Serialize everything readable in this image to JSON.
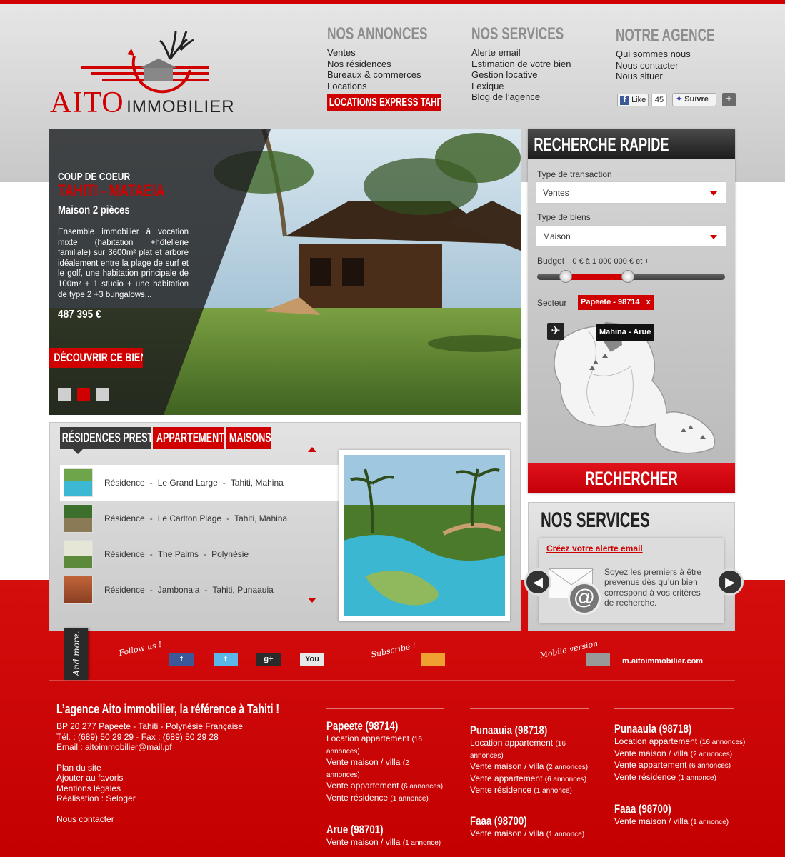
{
  "brand": {
    "name_main": "AITO",
    "name_sub": "IMMOBILIER"
  },
  "nav": {
    "annonces": {
      "title": "NOS ANNONCES",
      "items": [
        "Ventes",
        "Nos résidences",
        "Bureaux & commerces",
        "Locations"
      ],
      "highlight": "LOCATIONS EXPRESS TAHITI"
    },
    "services": {
      "title": "NOS SERVICES",
      "items": [
        "Alerte email",
        "Estimation de votre bien",
        "Gestion locative",
        "Lexique",
        "Blog de l’agence"
      ]
    },
    "agence": {
      "title": "NOTRE AGENCE",
      "items": [
        "Qui sommes nous",
        "Nous contacter",
        "Nous situer"
      ]
    }
  },
  "social_top": {
    "like_label": "Like",
    "like_count": "45",
    "follow_label": "Suivre",
    "plus_label": "+"
  },
  "hero": {
    "kicker": "COUP DE COEUR",
    "location": "TAHITI - MATAEIA",
    "type": "Maison 2 pièces",
    "description": "Ensemble immobilier à vocation mixte (habitation +hôtellerie familiale) sur 3600m² plat et arboré idéalement entre la plage de surf et le golf, une habitation principale de 100m² + 1 studio + une habitation de type 2 +3 bungalows...",
    "price": "487 395 €",
    "cta": "DÉCOUVRIR CE BIEN",
    "slides": [
      false,
      true,
      false
    ]
  },
  "search": {
    "title": "RECHERCHE RAPIDE",
    "transaction_label": "Type de transaction",
    "transaction_value": "Ventes",
    "biens_label": "Type de biens",
    "biens_value": "Maison",
    "budget_label": "Budget",
    "budget_value": "0 € à 1 000 000 € et +",
    "budget_range": [
      0,
      0.33
    ],
    "secteur_label": "Secteur",
    "secteur_tag": "Papeete - 98714",
    "secteur_remove": "x",
    "map_tooltip": "Mahina - Arue",
    "button": "RECHERCHER"
  },
  "residences": {
    "tabs": [
      "RÉSIDENCES PRESTIGE",
      "APPARTEMENTS",
      "MAISONS"
    ],
    "items": [
      {
        "kind": "Résidence",
        "name": "Le Grand Large",
        "place": "Tahiti, Mahina"
      },
      {
        "kind": "Résidence",
        "name": "Le Carlton Plage",
        "place": "Tahiti, Mahina"
      },
      {
        "kind": "Résidence",
        "name": "The Palms",
        "place": "Polynésie"
      },
      {
        "kind": "Résidence",
        "name": "Jambonala",
        "place": "Tahiti, Punaauia"
      }
    ]
  },
  "services_box": {
    "title": "NOS SERVICES",
    "link": "Créez votre alerte email",
    "text": "Soyez les premiers à être prevenus dès qu’un bien correspond à vos critères de recherche."
  },
  "follow": {
    "tab": "And more.",
    "follow_label": "Follow us !",
    "subscribe_label": "Subscribe !",
    "mobile_label": "Mobile version",
    "mobile_url": "m.aitoimmobilier.com",
    "icons": [
      "f",
      "t",
      "g+",
      "You"
    ]
  },
  "footer": {
    "title": "L’agence Aito immobilier, la référence à Tahiti !",
    "address": [
      "BP 20 277 Papeete - Tahiti - Polynésie Française",
      "Tél. : (689) 50 29 29 - Fax : (689) 50 29 28",
      "Email : aitoimmobilier@mail.pf"
    ],
    "links": [
      "Plan du site",
      "Ajouter au favoris",
      "Mentions légales",
      "Réalisation : Seloger"
    ],
    "contact": "Nous contacter",
    "cols": [
      {
        "city": "Papeete (98714)",
        "rows": [
          [
            "Location appartement",
            "(16 annonces)"
          ],
          [
            "Vente maison / villa",
            "(2 annonces)"
          ],
          [
            "Vente appartement",
            "(6 annonces)"
          ],
          [
            "Vente résidence",
            "(1 annonce)"
          ]
        ],
        "city2": "Arue (98701)",
        "rows2": [
          [
            "Vente maison / villa",
            "(1 annonce)"
          ]
        ]
      },
      {
        "city": "Punaauia (98718)",
        "rows": [
          [
            "Location appartement",
            "(16 annonces)"
          ],
          [
            "Vente maison / villa",
            "(2 annonces)"
          ],
          [
            "Vente appartement",
            "(6 annonces)"
          ],
          [
            "Vente résidence",
            "(1 annonce)"
          ]
        ],
        "city2": "Faaa (98700)",
        "rows2": [
          [
            "Vente maison / villa",
            "(1 annonce)"
          ]
        ]
      },
      {
        "city": "Punaauia (98718)",
        "rows": [
          [
            "Location appartement",
            "(16 annonces)"
          ],
          [
            "Vente maison / villa",
            "(2 annonces)"
          ],
          [
            "Vente appartement",
            "(6 annonces)"
          ],
          [
            "Vente résidence",
            "(1 annonce)"
          ]
        ],
        "city2": "Faaa (98700)",
        "rows2": [
          [
            "Vente maison / villa",
            "(1 annonce)"
          ]
        ]
      }
    ]
  },
  "colors": {
    "brand_red": "#d10000",
    "dark": "#2a2a2a"
  }
}
